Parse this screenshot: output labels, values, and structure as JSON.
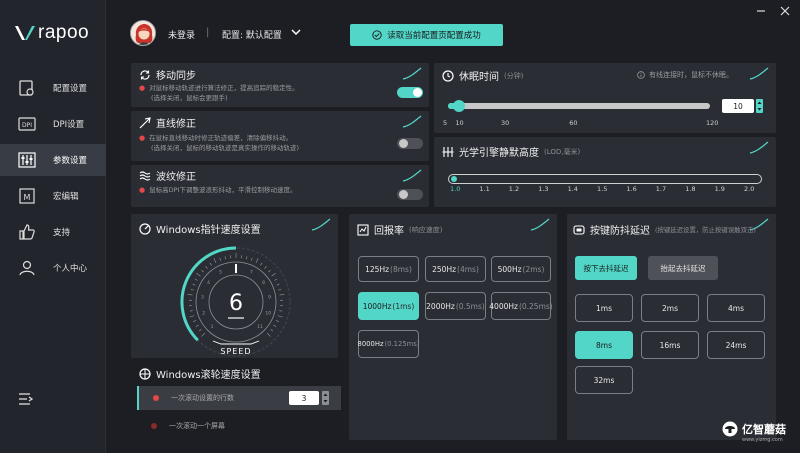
{
  "brand": {
    "name": "rapoo"
  },
  "sidebar": {
    "items": [
      {
        "label": "配置设置",
        "icon": "config-icon"
      },
      {
        "label": "DPI设置",
        "icon": "dpi-icon"
      },
      {
        "label": "参数设置",
        "icon": "sliders-icon",
        "active": true
      },
      {
        "label": "宏编辑",
        "icon": "macro-icon"
      },
      {
        "label": "支持",
        "icon": "thumbs-up-icon"
      },
      {
        "label": "个人中心",
        "icon": "user-icon"
      }
    ],
    "bottom_icon": "collapse-icon",
    "dpi_icon_text": "DPI",
    "macro_icon_text": "M"
  },
  "header": {
    "login_status": "未登录",
    "separator": "|",
    "config_label": "配置: 默认配置",
    "toast": "读取当前配置页配置成功"
  },
  "motion_sync": {
    "title": "移动同步",
    "desc1": "对鼠标移动轨迹进行算法修正，提高追踪的稳定性。",
    "desc2": "(选择关闭，鼠标会更跟手)",
    "enabled": true
  },
  "angle_snap": {
    "title": "直线修正",
    "desc1": "在鼠标直线移动时修正轨迹偏差，清除偏移抖动。",
    "desc2": "(选择关闭，鼠标的移动轨迹是真实操作的移动轨迹)",
    "enabled": false
  },
  "ripple": {
    "title": "波纹修正",
    "desc1": "鼠标高DPI下调整波浪形抖动，平滑控制移动速度。",
    "enabled": false
  },
  "sleep": {
    "title": "休眠时间",
    "unit": "(分钟)",
    "note": "有线连接时，鼠标不休眠。",
    "value": "10",
    "min": 5,
    "max": 120,
    "current": 10,
    "ticks": [
      "5",
      "10",
      "30",
      "60",
      "120"
    ]
  },
  "lod": {
    "title": "光学引擎静默高度",
    "unit": "(LOD,毫米)",
    "value": 1.0,
    "ticks": [
      "1.0",
      "1.1",
      "1.2",
      "1.3",
      "1.4",
      "1.5",
      "1.6",
      "1.7",
      "1.8",
      "1.9",
      "2.0"
    ]
  },
  "pointer_speed": {
    "title": "Windows指针速度设置",
    "value": "6",
    "label": "SPEED",
    "level": 6,
    "max": 11,
    "ticks": [
      "1",
      "2",
      "3",
      "4",
      "5",
      "6",
      "7",
      "8",
      "9",
      "10",
      "11"
    ]
  },
  "scroll": {
    "title": "Windows滚轮速度设置",
    "option1": "一次滚动设置的行数",
    "lines": "3",
    "option2": "一次滚动一个屏幕"
  },
  "polling": {
    "title": "回报率",
    "subtitle": "(响应速度)",
    "options": [
      {
        "main": "125Hz",
        "sub": "(8ms)"
      },
      {
        "main": "250Hz",
        "sub": "(4ms)"
      },
      {
        "main": "500Hz",
        "sub": "(2ms)"
      },
      {
        "main": "1000Hz",
        "sub": "(1ms)",
        "selected": true
      },
      {
        "main": "2000Hz",
        "sub": "(0.5ms)"
      },
      {
        "main": "4000Hz",
        "sub": "(0.25ms)"
      },
      {
        "main": "8000Hz",
        "sub": "(0.125ms)"
      }
    ]
  },
  "debounce": {
    "title": "按键防抖延迟",
    "subtitle": "(按键延迟设置，防止按键误触双击)",
    "tab_press": "按下去抖延迟",
    "tab_release": "抬起去抖延迟",
    "options": [
      "1ms",
      "2ms",
      "4ms",
      "8ms",
      "16ms",
      "24ms",
      "32ms"
    ],
    "selected": "8ms"
  },
  "watermark": {
    "name": "亿智蘑菇",
    "url": "www.yizmg.com"
  },
  "colors": {
    "accent": "#52d6c8",
    "panel": "#2a2d33",
    "bg": "#1c1e23",
    "alert": "#e24848"
  }
}
